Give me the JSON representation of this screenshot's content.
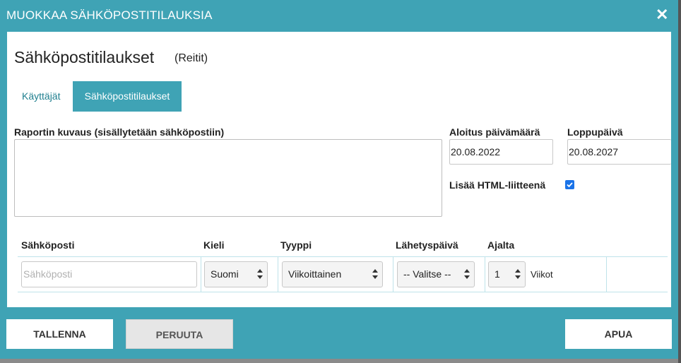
{
  "dialog": {
    "title": "MUOKKAA SÄHKÖPOSTITILAUKSIA",
    "close_icon": "close-icon"
  },
  "header": {
    "title": "Sähköpostitilaukset",
    "subtitle": "(Reitit)"
  },
  "tabs": [
    {
      "label": "Käyttäjät",
      "active": false
    },
    {
      "label": "Sähköpostitilaukset",
      "active": true
    }
  ],
  "form": {
    "description_label": "Raportin kuvaus (sisällytetään sähköpostiin)",
    "description_value": "",
    "start_date_label": "Aloitus päivämäärä",
    "start_date_value": "20.08.2022",
    "end_date_label": "Loppupäivä",
    "end_date_value": "20.08.2027",
    "html_attachment_label": "Lisää HTML-liitteenä",
    "html_attachment_checked": true
  },
  "subscription_table": {
    "headers": [
      "Sähköposti",
      "Kieli",
      "Tyyppi",
      "Lähetyspäivä",
      "Ajalta"
    ],
    "row": {
      "email_placeholder": "Sähköposti",
      "language": "Suomi",
      "type": "Viikoittainen",
      "send_day": "-- Valitse --",
      "period_value": "1",
      "period_unit": "Viikot"
    }
  },
  "buttons": {
    "save": "TALLENNA",
    "cancel": "PERUUTA",
    "help": "APUA"
  },
  "colors": {
    "accent": "#3fa3b5",
    "checkbox": "#1a73e8"
  }
}
